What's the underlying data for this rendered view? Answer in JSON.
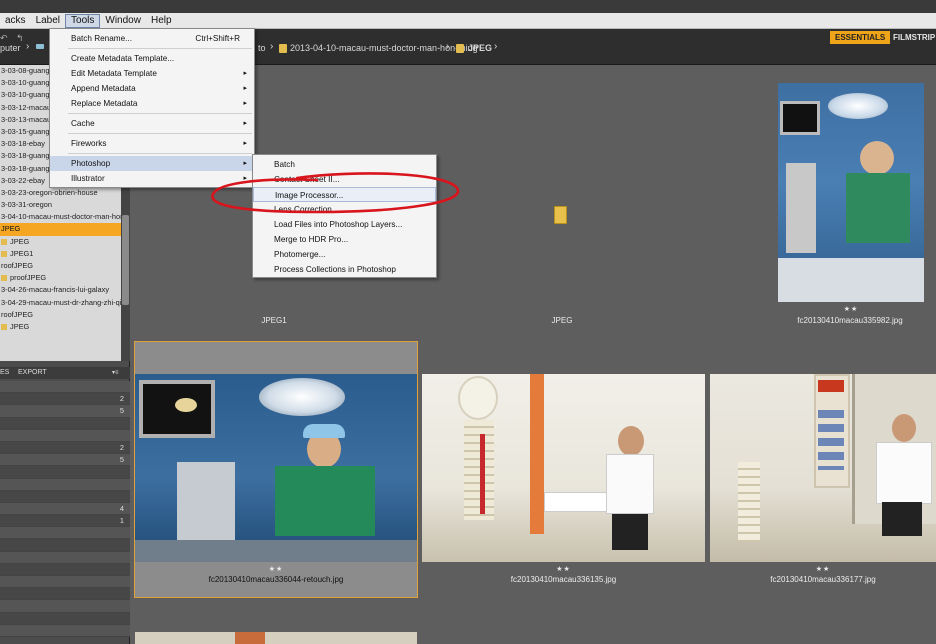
{
  "menubar": {
    "items": [
      "acks",
      "Label",
      "Tools",
      "Window",
      "Help"
    ],
    "active": "Tools"
  },
  "path": {
    "left_prefix": "puter",
    "to_fragment": "to",
    "folder": "2013-04-10-macau-must-doctor-man-hon-ming",
    "subfolder": "JPEG"
  },
  "workspace": {
    "essentials": "ESSENTIALS",
    "filmstrip": "FILMSTRIP"
  },
  "folder_tree": {
    "items": [
      {
        "label": "3-03-08-guang",
        "selected": false,
        "folder": false
      },
      {
        "label": "3-03-10-guang",
        "selected": false,
        "folder": false
      },
      {
        "label": "3-03-10-guang",
        "selected": false,
        "folder": false
      },
      {
        "label": "3-03-12-macau",
        "selected": false,
        "folder": false
      },
      {
        "label": "3-03-13-macau",
        "selected": false,
        "folder": false
      },
      {
        "label": "3-03-15-guang",
        "selected": false,
        "folder": false
      },
      {
        "label": "3-03-18-ebay",
        "selected": false,
        "folder": false
      },
      {
        "label": "3-03-18-guang",
        "selected": false,
        "folder": false
      },
      {
        "label": "3-03-18-guangdong-metro",
        "selected": false,
        "folder": false
      },
      {
        "label": "3-03-22-ebay",
        "selected": false,
        "folder": false
      },
      {
        "label": "3-03-23-oregon-obrien-house",
        "selected": false,
        "folder": false
      },
      {
        "label": "3-03-31-oregon",
        "selected": false,
        "folder": false
      },
      {
        "label": "3-04-10-macau-must-doctor-man-hon",
        "selected": false,
        "folder": false
      },
      {
        "label": "JPEG",
        "selected": true,
        "folder": false
      },
      {
        "label": "JPEG",
        "selected": false,
        "folder": true
      },
      {
        "label": "JPEG1",
        "selected": false,
        "folder": true
      },
      {
        "label": "roofJPEG",
        "selected": false,
        "folder": false
      },
      {
        "label": "proofJPEG",
        "selected": false,
        "folder": true
      },
      {
        "label": "3-04-26-macau-francis-lui-galaxy",
        "selected": false,
        "folder": false
      },
      {
        "label": "3-04-29-macau-must-dr-zhang-zhi-qi",
        "selected": false,
        "folder": false
      },
      {
        "label": "roofJPEG",
        "selected": false,
        "folder": false
      },
      {
        "label": "JPEG",
        "selected": false,
        "folder": true
      }
    ]
  },
  "lower_tabs": {
    "tab1": "ES",
    "tab2": "EXPORT"
  },
  "filter_counts": [
    "",
    "2",
    "5",
    "",
    "",
    "2",
    "5",
    "",
    "",
    "",
    "4",
    "1",
    "",
    "",
    "",
    "",
    "",
    "",
    "",
    "",
    ""
  ],
  "tools_menu": {
    "items": [
      {
        "label": "Batch Rename...",
        "shortcut": "Ctrl+Shift+R",
        "arrow": false
      },
      {
        "label": "Create Metadata Template...",
        "shortcut": "",
        "arrow": false
      },
      {
        "label": "Edit Metadata Template",
        "shortcut": "",
        "arrow": true
      },
      {
        "label": "Append Metadata",
        "shortcut": "",
        "arrow": true
      },
      {
        "label": "Replace Metadata",
        "shortcut": "",
        "arrow": true
      },
      {
        "label": "Cache",
        "shortcut": "",
        "arrow": true
      },
      {
        "label": "Fireworks",
        "shortcut": "",
        "arrow": true
      },
      {
        "label": "Photoshop",
        "shortcut": "",
        "arrow": true
      },
      {
        "label": "Illustrator",
        "shortcut": "",
        "arrow": true
      }
    ]
  },
  "photoshop_submenu": {
    "items": [
      "Batch",
      "Contact Sheet II...",
      "Image Processor...",
      "Lens Correction...",
      "Load Files into Photoshop Layers...",
      "Merge to HDR Pro...",
      "Photomerge...",
      "Process Collections in Photoshop"
    ]
  },
  "thumbnails": [
    {
      "label": "JPEG1",
      "stars": ""
    },
    {
      "label": "JPEG",
      "stars": ""
    },
    {
      "label": "fc20130410macau335982.jpg",
      "stars": "★★"
    },
    {
      "label": "fc20130410macau336044-retouch.jpg",
      "stars": "★★"
    },
    {
      "label": "fc20130410macau336135.jpg",
      "stars": "★★"
    },
    {
      "label": "fc20130410macau336177.jpg",
      "stars": "★★"
    }
  ],
  "colors": {
    "accent": "#f0a418",
    "annotation": "#d8141c",
    "selection": "#f5a623"
  }
}
